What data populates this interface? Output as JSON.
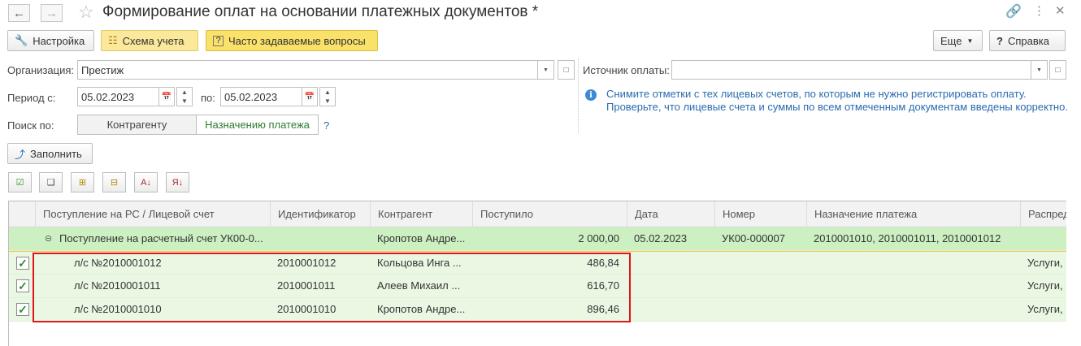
{
  "window": {
    "title": "Формирование оплат на основании платежных документов *",
    "back_icon": "arrow-left-icon",
    "forward_icon": "arrow-right-icon"
  },
  "toolbar": {
    "settings_label": "Настройка",
    "schema_label": "Схема учета",
    "faq_label": "Часто задаваемые вопросы",
    "more_label": "Еще",
    "help_label": "Справка"
  },
  "form": {
    "org_label": "Организация:",
    "org_value": "Престиж",
    "source_label": "Источник оплаты:",
    "source_value": "",
    "period_from_label": "Период с:",
    "period_from_value": "05.02.2023",
    "period_to_label": "по:",
    "period_to_value": "05.02.2023",
    "search_label": "Поиск по:",
    "search_options": [
      "Контрагенту",
      "Назначению платежа"
    ],
    "search_help": "?",
    "fill_label": "Заполнить"
  },
  "info": {
    "line1": "Снимите отметки с тех лицевых счетов, по которым не нужно регистрировать оплату.",
    "line2": "Проверьте, что лицевые счета и суммы по всем отмеченным документам введены корректно."
  },
  "table": {
    "columns": [
      "Поступление на РС / Лицевой счет",
      "Идентификатор",
      "Контрагент",
      "Поступило",
      "Дата",
      "Номер",
      "Назначение платежа",
      "Распред"
    ],
    "group_row": {
      "doc": "Поступление на расчетный счет УК00-0...",
      "counterparty": "Кропотов Андре...",
      "amount": "2 000,00",
      "date": "05.02.2023",
      "number": "УК00-000007",
      "purpose": "2010001010, 2010001011, 2010001012"
    },
    "rows": [
      {
        "account": "л/с №2010001012",
        "id": "2010001012",
        "counterparty": "Кольцова Инга ...",
        "amount": "486,84",
        "dist": "Услуги,"
      },
      {
        "account": "л/с №2010001011",
        "id": "2010001011",
        "counterparty": "Алеев Михаил ...",
        "amount": "616,70",
        "dist": "Услуги,"
      },
      {
        "account": "л/с №2010001010",
        "id": "2010001010",
        "counterparty": "Кропотов Андре...",
        "amount": "896,46",
        "dist": "Услуги,"
      }
    ]
  },
  "colors": {
    "group_row_bg": "#ccf0c2",
    "row_bg": "#eaf7e3",
    "highlight_frame": "#e0161b",
    "faq_bg": "#f9e16a",
    "info_text": "#2a6bb0"
  }
}
